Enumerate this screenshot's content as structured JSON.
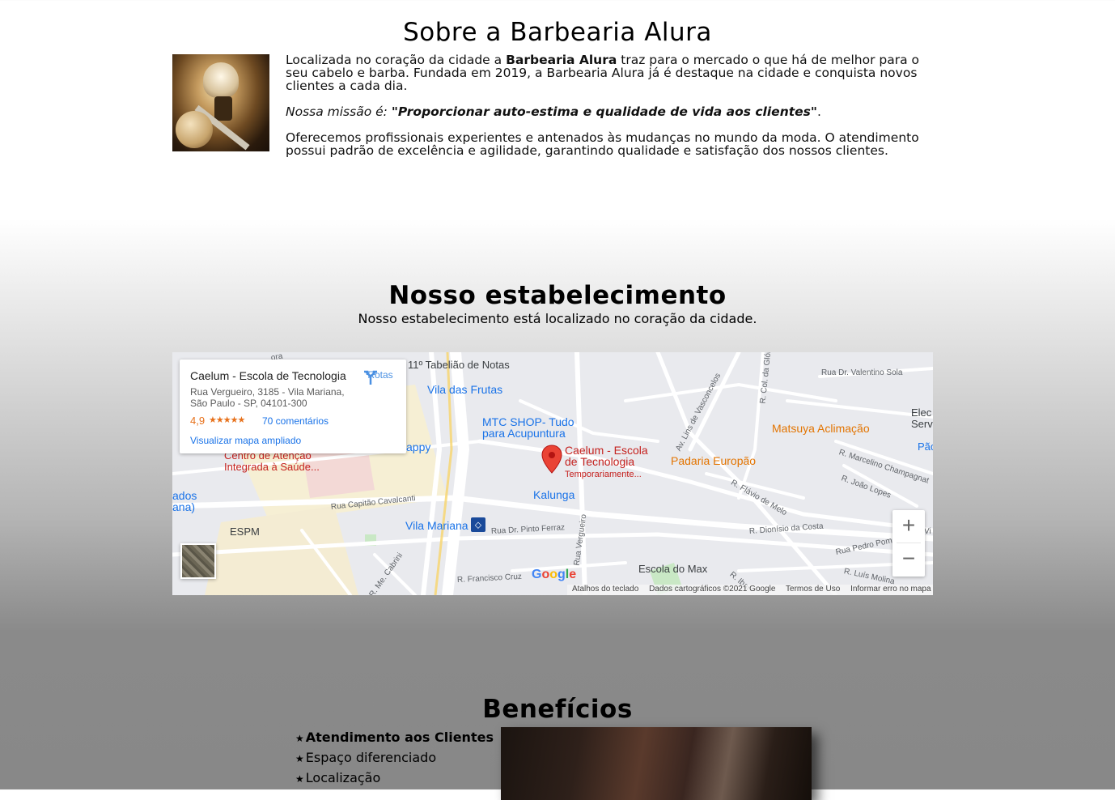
{
  "sobre": {
    "title": "Sobre a Barbearia Alura",
    "p1_before": "Localizada no coração da cidade a ",
    "p1_bold": "Barbearia Alura",
    "p1_after": " traz para o mercado o que há de melhor para o seu cabelo e barba. Fundada em 2019, a Barbearia Alura já é destaque na cidade e conquista novos clientes a cada dia.",
    "mission_prefix": "Nossa missão é: ",
    "mission_bold": "\"Proporcionar auto-estima e qualidade de vida aos clientes\"",
    "mission_suffix": ".",
    "p3": "Oferecemos profissionais experientes e antenados às mudanças no mundo da moda. O atendimento possui padrão de excelência e agilidade, garantindo qualidade e satisfação dos nossos clientes."
  },
  "estabelecimento": {
    "title": "Nosso estabelecimento",
    "subtitle": "Nosso estabelecimento está localizado no coração da cidade."
  },
  "map": {
    "card": {
      "name": "Caelum - Escola de Tecnologia",
      "address": "Rua Vergueiro, 3185 - Vila Mariana, São Paulo - SP, 04101-300",
      "rating": "4,9",
      "stars": "★★★★★",
      "reviews": "70 comentários",
      "view_larger": "Visualizar mapa ampliado",
      "directions": "Rotas"
    },
    "labels": {
      "tabeliao": "11º Tabelião de Notas",
      "vila_frutas": "Vila das Frutas",
      "mtc_1": "MTC SHOP- Tudo",
      "mtc_2": "para Acupuntura",
      "happy": "appy",
      "centro_1": "Centro de Atenção",
      "centro_2": "Integrada à Saúde...",
      "caelum_1": "Caelum - Escola",
      "caelum_2": "de Tecnologia",
      "caelum_3": "Temporariamente...",
      "kalunga": "Kalunga",
      "vila_mariana": "Vila Mariana",
      "espm": "ESPM",
      "ados": "ados",
      "ana": "ana)",
      "matsuya": "Matsuya Aclimação",
      "padaria": "Padaria Europão",
      "escola_max": "Escola do Max",
      "elec": "Elec",
      "servic": "Servic",
      "pao": "Pão",
      "rua_valentino": "Rua Dr. Valentino Sola",
      "rua_marcelino": "R. Marcelino Champagnat",
      "rua_joao": "R. João Lopes",
      "rua_flavio": "R. Flávio de Melo",
      "rua_dionisio": "R. Dionísio da Costa",
      "rua_pedro": "Rua Pedro Pom",
      "rua_luis": "R. Luís Molina",
      "rua_capitao": "Rua Capitão Cavalcanti",
      "rua_pinto": "Rua Dr. Pinto Ferraz",
      "rua_vergueiro": "Rua Vergueiro",
      "rua_francisco": "R. Francisco Cruz",
      "av_lins": "Av. Lins de Vasconcelos",
      "r_col": "R. Col. da Glória",
      "r_ibar": "R. Ibar",
      "me_cabrini": "R. Me. Cabrini",
      "vi": "Vi",
      "ora": "ora"
    },
    "google": "Google",
    "attribution": {
      "keyboard": "Atalhos do teclado",
      "data": "Dados cartográficos ©2021 Google",
      "terms": "Termos de Uso",
      "report": "Informar erro no mapa"
    },
    "zoom_in": "+",
    "zoom_out": "−"
  },
  "beneficios": {
    "title": "Benefícios",
    "items": [
      {
        "label": "Atendimento aos Clientes"
      },
      {
        "label": "Espaço diferenciado"
      },
      {
        "label": "Localização"
      }
    ]
  },
  "colors": {
    "map_blue": "#1a73e8",
    "map_orange": "#e37400",
    "map_red": "#c5221f",
    "rating_orange": "#e7711b"
  }
}
